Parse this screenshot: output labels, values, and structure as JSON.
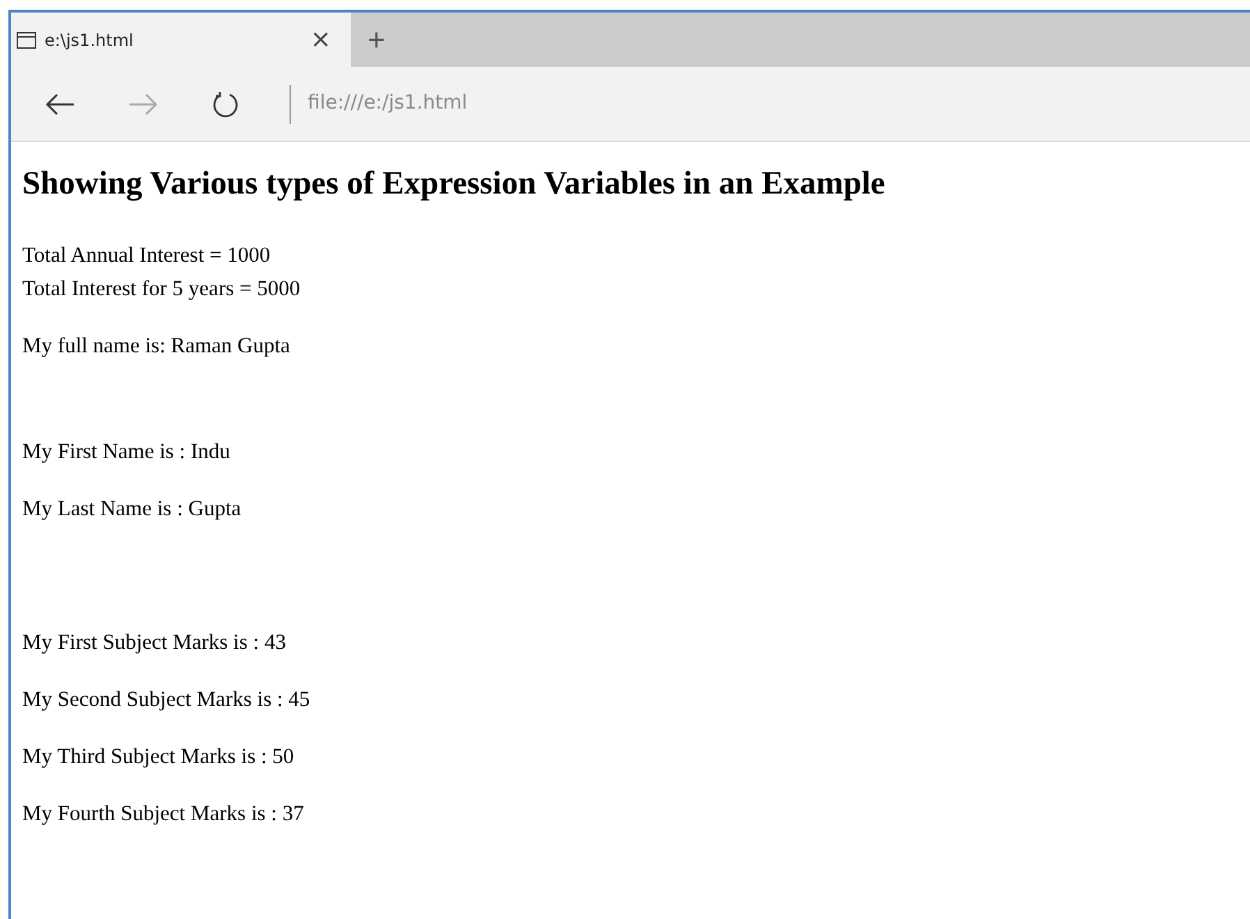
{
  "browser": {
    "tab": {
      "title": "e:\\js1.html",
      "close": "×",
      "selected": true
    },
    "new_tab": "+",
    "nav": {
      "back_disabled": false,
      "forward_disabled": true
    },
    "address": "file:///e:/js1.html"
  },
  "page": {
    "heading": "Showing Various types of Expression Variables in an Example",
    "blocks": [
      {
        "kind": "para",
        "lines": [
          "Total Annual Interest = 1000",
          "Total Interest for 5 years = 5000"
        ]
      },
      {
        "kind": "para",
        "lines": [
          "My full name is: Raman Gupta"
        ]
      },
      {
        "kind": "gap"
      },
      {
        "kind": "para",
        "lines": [
          "My First Name is : Indu"
        ]
      },
      {
        "kind": "para",
        "lines": [
          "My Last Name is : Gupta"
        ]
      },
      {
        "kind": "gap"
      },
      {
        "kind": "break"
      },
      {
        "kind": "para",
        "lines": [
          "My First Subject Marks is : 43"
        ]
      },
      {
        "kind": "para",
        "lines": [
          "My Second Subject Marks is : 45"
        ]
      },
      {
        "kind": "para",
        "lines": [
          "My Third Subject Marks is : 50"
        ]
      },
      {
        "kind": "para",
        "lines": [
          "My Fourth Subject Marks is : 37"
        ]
      }
    ]
  }
}
